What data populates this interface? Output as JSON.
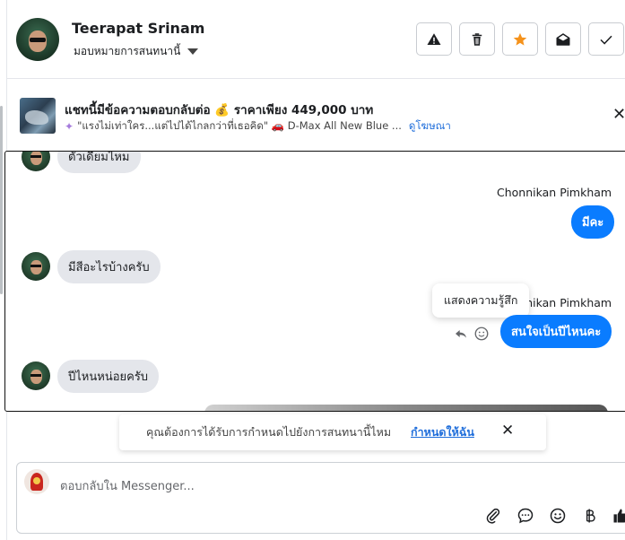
{
  "header": {
    "name": "Teerapat Srinam",
    "assign_label": "มอบหมายการสนทนานี้",
    "buttons": [
      {
        "id": "report",
        "icon": "warning-icon"
      },
      {
        "id": "delete",
        "icon": "trash-icon"
      },
      {
        "id": "star",
        "icon": "star-icon",
        "color": "#f5921b"
      },
      {
        "id": "mark-unread",
        "icon": "envelope-open-icon"
      },
      {
        "id": "done",
        "icon": "checkmark-icon"
      }
    ]
  },
  "ad": {
    "title": "แชทนี้มีข้อความตอบกลับต่อ 💰 ราคาเพียง 449,000 บาท",
    "subtitle": "\"แรงไม่เท่าใคร...แต่ไปได้ไกลกว่าที่เธอคิด\" 🚗 D-Max All New Blue ...",
    "link": "ดูโฆษณา"
  },
  "conversation": {
    "messages": [
      {
        "direction": "in",
        "text": "ตัวเดียมไหม"
      },
      {
        "direction": "out",
        "sender": "Chonnikan Pimkham",
        "text": "มีคะ"
      },
      {
        "direction": "in",
        "text": "มีสีอะไรบ้างครับ"
      },
      {
        "direction": "out",
        "sender": "Chonnikan Pimkham",
        "text": "สนใจเป็นปีไหนคะ"
      },
      {
        "direction": "in",
        "text": "ปีไหนหน่อยครับ"
      }
    ],
    "tooltip": "แสดงความรู้สึก"
  },
  "notice": {
    "text": "คุณต้องการได้รับการกำหนดไปยังการสนทนานี้ไหม",
    "link": "กำหนดให้ฉัน"
  },
  "composer": {
    "placeholder": "ตอบกลับใน Messenger...",
    "tools": [
      "paperclip-icon",
      "chat-bubble-icon",
      "emoji-icon",
      "baht-icon",
      "thumbs-up-icon"
    ]
  },
  "colors": {
    "accent": "#0a7cff",
    "link": "#216fdb",
    "star": "#f5921b",
    "incoming_bubble": "#e4e6eb"
  }
}
